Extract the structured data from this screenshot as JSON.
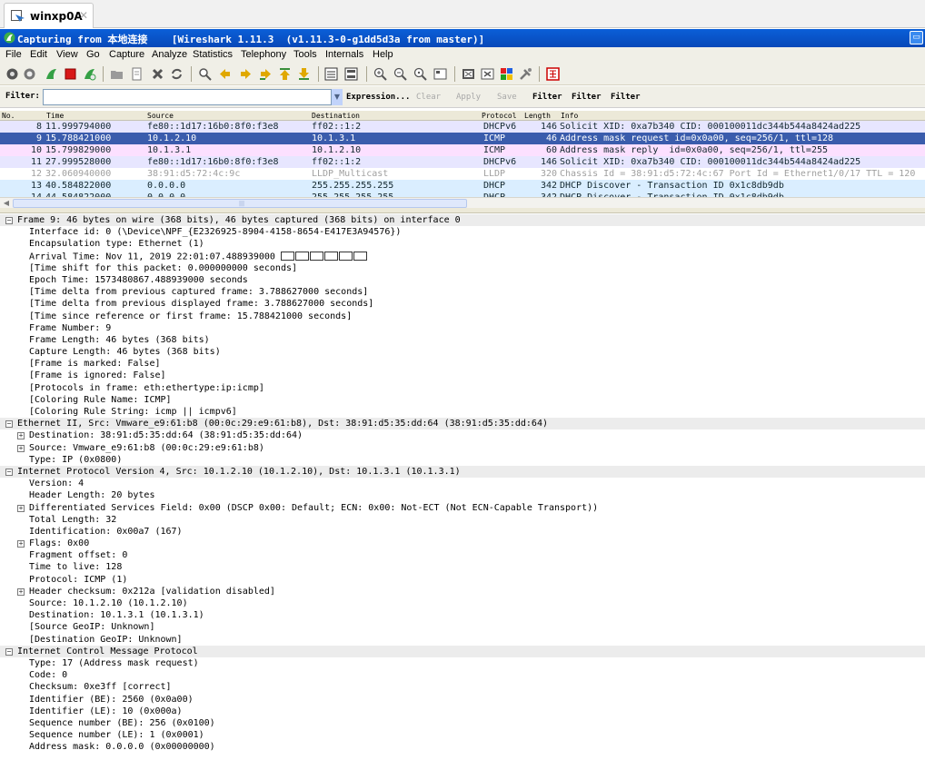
{
  "vm_tab": {
    "label": "winxp0A",
    "close": "✕"
  },
  "window": {
    "title": "Capturing from 本地连接    [Wireshark 1.11.3  (v1.11.3-0-g1dd5d3a from master)]",
    "restore_button": "▭"
  },
  "menu": [
    "File",
    "Edit",
    "View",
    "Go",
    "Capture",
    "Analyze",
    "Statistics",
    "Telephony",
    "Tools",
    "Internals",
    "Help"
  ],
  "toolbar_icons": [
    "interfaces-icon",
    "options-icon",
    "start-capture-icon",
    "stop-capture-icon",
    "restart-capture-icon",
    "open-file-icon",
    "save-file-icon",
    "close-file-icon",
    "reload-icon",
    "find-packet-icon",
    "go-back-icon",
    "go-forward-icon",
    "go-to-packet-icon",
    "go-first-icon",
    "go-last-icon",
    "colorize-icon",
    "auto-scroll-icon",
    "zoom-in-icon",
    "zoom-out-icon",
    "zoom-normal-icon",
    "resize-columns-icon",
    "capture-filters-icon",
    "display-filters-icon",
    "coloring-rules-icon",
    "preferences-icon",
    "help-icon"
  ],
  "filter": {
    "label": "Filter:",
    "value": "",
    "expression": "Expression...",
    "clear": "Clear",
    "apply": "Apply",
    "save": "Save",
    "extra_buttons": [
      "Filter",
      "Filter",
      "Filter"
    ]
  },
  "packet_list": {
    "headers": {
      "no": "No.",
      "time": "Time",
      "source": "Source",
      "destination": "Destination",
      "protocol": "Protocol",
      "length": "Length",
      "info": "Info"
    },
    "rows": [
      {
        "no": "8",
        "time": "11.999794000",
        "source": "fe80::1d17:16b0:8f0:f3e8",
        "destination": "ff02::1:2",
        "protocol": "DHCPv6",
        "length": "146",
        "info": "Solicit XID: 0xa7b340 CID: 000100011dc344b544a8424ad225",
        "bg": "#e7e6ff",
        "fg": "#12272e",
        "selected": false
      },
      {
        "no": "9",
        "time": "15.788421000",
        "source": "10.1.2.10",
        "destination": "10.1.3.1",
        "protocol": "ICMP",
        "length": "46",
        "info": "Address mask request id=0x0a00, seq=256/1, ttl=128",
        "bg": "#3a5cac",
        "fg": "#ffffff",
        "selected": true
      },
      {
        "no": "10",
        "time": "15.799829000",
        "source": "10.1.3.1",
        "destination": "10.1.2.10",
        "protocol": "ICMP",
        "length": "60",
        "info": "Address mask reply  id=0x0a00, seq=256/1, ttl=255",
        "bg": "#fce0ff",
        "fg": "#12272e",
        "selected": false
      },
      {
        "no": "11",
        "time": "27.999528000",
        "source": "fe80::1d17:16b0:8f0:f3e8",
        "destination": "ff02::1:2",
        "protocol": "DHCPv6",
        "length": "146",
        "info": "Solicit XID: 0xa7b340 CID: 000100011dc344b544a8424ad225",
        "bg": "#e7e6ff",
        "fg": "#12272e",
        "selected": false
      },
      {
        "no": "12",
        "time": "32.060940000",
        "source": "38:91:d5:72:4c:9c",
        "destination": "LLDP_Multicast",
        "protocol": "LLDP",
        "length": "320",
        "info": "Chassis Id = 38:91:d5:72:4c:67 Port Id = Ethernet1/0/17 TTL = 120",
        "bg": "#ffffff",
        "fg": "#a0a0a0",
        "selected": false
      },
      {
        "no": "13",
        "time": "40.584822000",
        "source": "0.0.0.0",
        "destination": "255.255.255.255",
        "protocol": "DHCP",
        "length": "342",
        "info": "DHCP Discover - Transaction ID 0x1c8db9db",
        "bg": "#daeeff",
        "fg": "#12272e",
        "selected": false
      },
      {
        "no": "14",
        "time": "44.584822000",
        "source": "0.0.0.0",
        "destination": "255.255.255.255",
        "protocol": "DHCP",
        "length": "342",
        "info": "DHCP Discover - Transaction ID 0x1c8db9db",
        "bg": "#daeeff",
        "fg": "#12272e",
        "selected": false
      }
    ]
  },
  "details": [
    {
      "level": 0,
      "exp": "⊟",
      "section": true,
      "text": "Frame 9: 46 bytes on wire (368 bits), 46 bytes captured (368 bits) on interface 0"
    },
    {
      "level": 1,
      "text": "Interface id: 0 (\\Device\\NPF_{E2326925-8904-4158-8654-E417E3A94576})"
    },
    {
      "level": 1,
      "text": "Encapsulation type: Ethernet (1)"
    },
    {
      "level": 1,
      "text": "Arrival Time: Nov 11, 2019 22:01:07.488939000 ",
      "boxes": 6
    },
    {
      "level": 1,
      "text": "[Time shift for this packet: 0.000000000 seconds]"
    },
    {
      "level": 1,
      "text": "Epoch Time: 1573480867.488939000 seconds"
    },
    {
      "level": 1,
      "text": "[Time delta from previous captured frame: 3.788627000 seconds]"
    },
    {
      "level": 1,
      "text": "[Time delta from previous displayed frame: 3.788627000 seconds]"
    },
    {
      "level": 1,
      "text": "[Time since reference or first frame: 15.788421000 seconds]"
    },
    {
      "level": 1,
      "text": "Frame Number: 9"
    },
    {
      "level": 1,
      "text": "Frame Length: 46 bytes (368 bits)"
    },
    {
      "level": 1,
      "text": "Capture Length: 46 bytes (368 bits)"
    },
    {
      "level": 1,
      "text": "[Frame is marked: False]"
    },
    {
      "level": 1,
      "text": "[Frame is ignored: False]"
    },
    {
      "level": 1,
      "text": "[Protocols in frame: eth:ethertype:ip:icmp]"
    },
    {
      "level": 1,
      "text": "[Coloring Rule Name: ICMP]"
    },
    {
      "level": 1,
      "text": "[Coloring Rule String: icmp || icmpv6]"
    },
    {
      "level": 0,
      "exp": "⊟",
      "section": true,
      "text": "Ethernet II, Src: Vmware_e9:61:b8 (00:0c:29:e9:61:b8), Dst: 38:91:d5:35:dd:64 (38:91:d5:35:dd:64)"
    },
    {
      "level": 1,
      "exp": "⊞",
      "text": "Destination: 38:91:d5:35:dd:64 (38:91:d5:35:dd:64)"
    },
    {
      "level": 1,
      "exp": "⊞",
      "text": "Source: Vmware_e9:61:b8 (00:0c:29:e9:61:b8)"
    },
    {
      "level": 1,
      "text": "Type: IP (0x0800)"
    },
    {
      "level": 0,
      "exp": "⊟",
      "section": true,
      "text": "Internet Protocol Version 4, Src: 10.1.2.10 (10.1.2.10), Dst: 10.1.3.1 (10.1.3.1)"
    },
    {
      "level": 1,
      "text": "Version: 4"
    },
    {
      "level": 1,
      "text": "Header Length: 20 bytes"
    },
    {
      "level": 1,
      "exp": "⊞",
      "text": "Differentiated Services Field: 0x00 (DSCP 0x00: Default; ECN: 0x00: Not-ECT (Not ECN-Capable Transport))"
    },
    {
      "level": 1,
      "text": "Total Length: 32"
    },
    {
      "level": 1,
      "text": "Identification: 0x00a7 (167)"
    },
    {
      "level": 1,
      "exp": "⊞",
      "text": "Flags: 0x00"
    },
    {
      "level": 1,
      "text": "Fragment offset: 0"
    },
    {
      "level": 1,
      "text": "Time to live: 128"
    },
    {
      "level": 1,
      "text": "Protocol: ICMP (1)"
    },
    {
      "level": 1,
      "exp": "⊞",
      "text": "Header checksum: 0x212a [validation disabled]"
    },
    {
      "level": 1,
      "text": "Source: 10.1.2.10 (10.1.2.10)"
    },
    {
      "level": 1,
      "text": "Destination: 10.1.3.1 (10.1.3.1)"
    },
    {
      "level": 1,
      "text": "[Source GeoIP: Unknown]"
    },
    {
      "level": 1,
      "text": "[Destination GeoIP: Unknown]"
    },
    {
      "level": 0,
      "exp": "⊟",
      "section": true,
      "text": "Internet Control Message Protocol"
    },
    {
      "level": 1,
      "text": "Type: 17 (Address mask request)"
    },
    {
      "level": 1,
      "text": "Code: 0"
    },
    {
      "level": 1,
      "text": "Checksum: 0xe3ff [correct]"
    },
    {
      "level": 1,
      "text": "Identifier (BE): 2560 (0x0a00)"
    },
    {
      "level": 1,
      "text": "Identifier (LE): 10 (0x000a)"
    },
    {
      "level": 1,
      "text": "Sequence number (BE): 256 (0x0100)"
    },
    {
      "level": 1,
      "text": "Sequence number (LE): 1 (0x0001)"
    },
    {
      "level": 1,
      "text": "Address mask: 0.0.0.0 (0x00000000)"
    }
  ]
}
